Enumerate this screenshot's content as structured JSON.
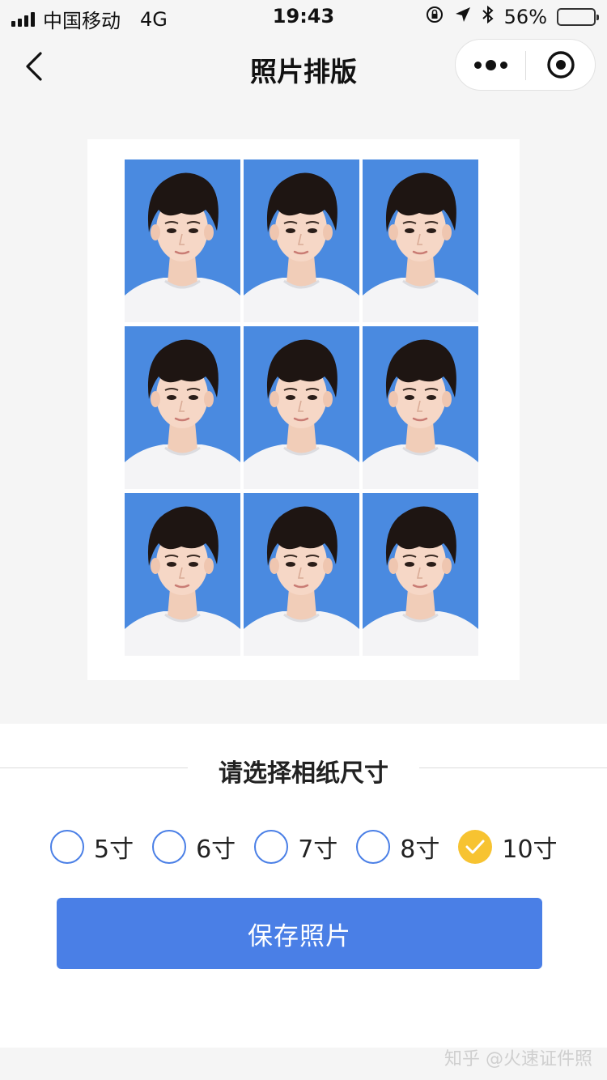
{
  "status_bar": {
    "carrier": "中国移动",
    "network": "4G",
    "time": "19:43",
    "battery_percent": "56%",
    "battery_level": 0.56
  },
  "nav": {
    "title": "照片排版",
    "back_icon": "chevron-left-icon",
    "more_icon": "more-dots-icon",
    "close_icon": "target-circle-icon"
  },
  "preview": {
    "rows": 3,
    "columns": 3,
    "photo_background": "#4a8ae0"
  },
  "size_picker": {
    "heading": "请选择相纸尺寸",
    "options": [
      {
        "label": "5寸",
        "checked": false
      },
      {
        "label": "6寸",
        "checked": false
      },
      {
        "label": "7寸",
        "checked": false
      },
      {
        "label": "8寸",
        "checked": false
      },
      {
        "label": "10寸",
        "checked": true
      }
    ],
    "accent_color": "#4a7fe6",
    "checked_color": "#f7c331"
  },
  "actions": {
    "save_label": "保存照片"
  },
  "watermark": "知乎 @火速证件照"
}
